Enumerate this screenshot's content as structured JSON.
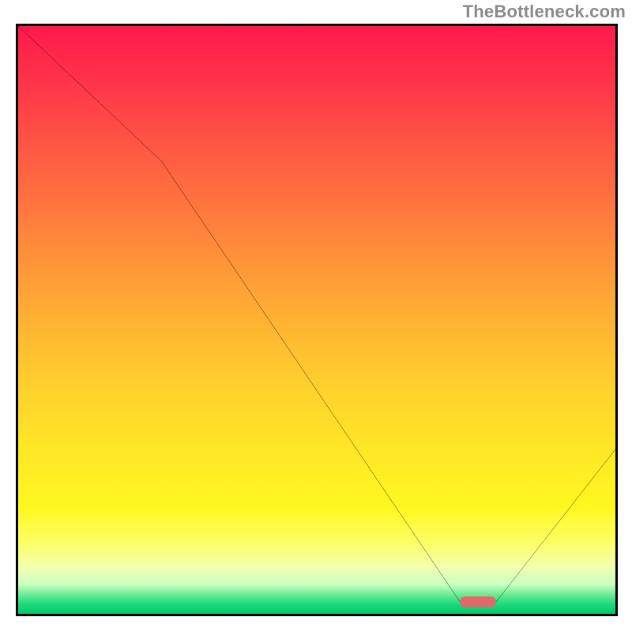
{
  "watermark": "TheBottleneck.com",
  "chart_data": {
    "type": "line",
    "title": "",
    "xlabel": "",
    "ylabel": "",
    "xlim": [
      0,
      100
    ],
    "ylim": [
      0,
      100
    ],
    "grid": false,
    "legend": false,
    "x": [
      0,
      24,
      74,
      80,
      100
    ],
    "values": [
      100,
      77,
      2,
      2,
      28
    ],
    "background_gradient": {
      "direction": "vertical",
      "stops": [
        {
          "pos": 0.0,
          "color": "#ff1a4b"
        },
        {
          "pos": 0.5,
          "color": "#ffb732"
        },
        {
          "pos": 0.85,
          "color": "#fff820"
        },
        {
          "pos": 1.0,
          "color": "#00c96b"
        }
      ],
      "semantics": "red=high bottleneck, green=low bottleneck"
    },
    "optimal_marker": {
      "x_start": 74,
      "x_end": 80,
      "y": 2,
      "color": "#e06a6a"
    }
  },
  "colors": {
    "curve": "#000000",
    "frame": "#000000",
    "watermark": "#8a8a8a",
    "marker": "#e06a6a"
  }
}
